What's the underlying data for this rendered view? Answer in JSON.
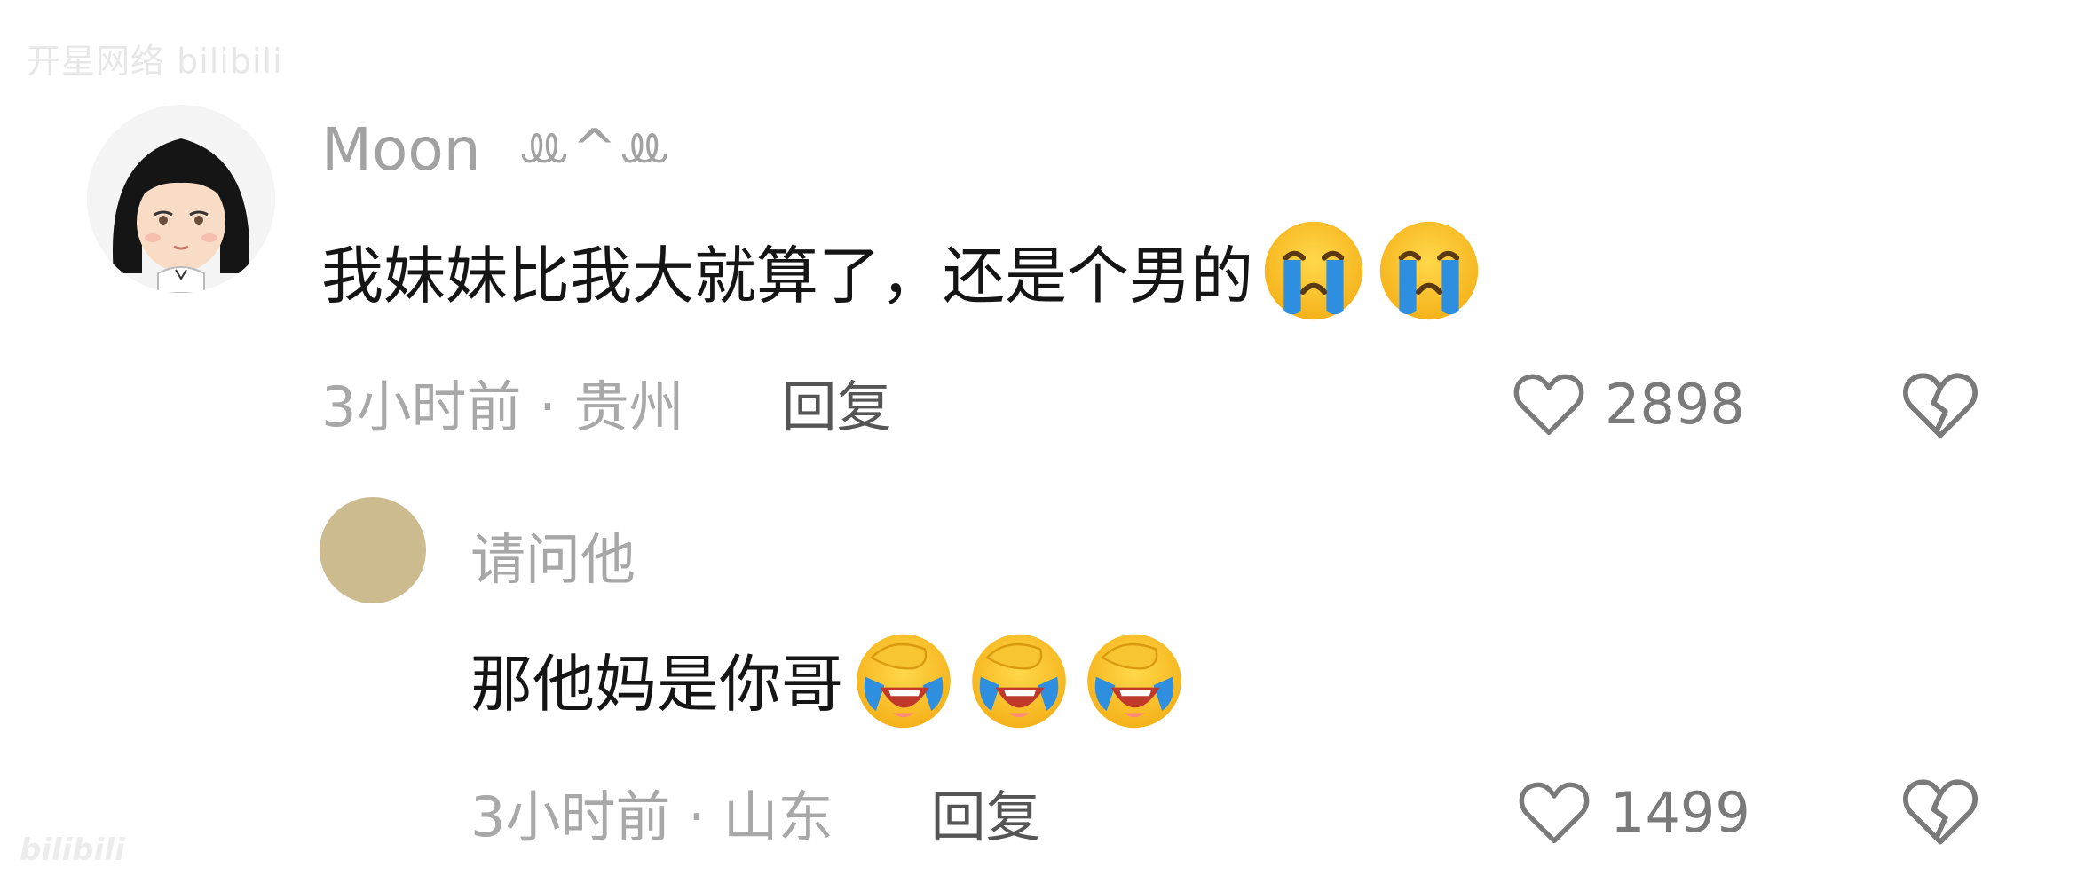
{
  "watermarks": {
    "top": "开星网络 bilibili",
    "bottom": "bilibili"
  },
  "comments": [
    {
      "username": "Moon",
      "username_deco": "ꔛ^ꔛ",
      "text": "我妹妹比我大就算了，还是个男的",
      "emojis": [
        "loudly-crying-face-icon",
        "loudly-crying-face-icon"
      ],
      "time_location": "3小时前 · 贵州",
      "reply_label": "回复",
      "likes": "2898"
    },
    {
      "username": "请问他",
      "text": "那他妈是你哥",
      "emojis": [
        "laugh-cry-facepalm-icon",
        "laugh-cry-facepalm-icon",
        "laugh-cry-facepalm-icon"
      ],
      "time_location": "3小时前 · 山东",
      "reply_label": "回复",
      "likes": "1499"
    }
  ],
  "colors": {
    "meta_gray": "#a8a8a8",
    "reply_gray": "#555555",
    "icon_gray": "#7a7a7a",
    "reply_avatar": "#cdbb90"
  }
}
